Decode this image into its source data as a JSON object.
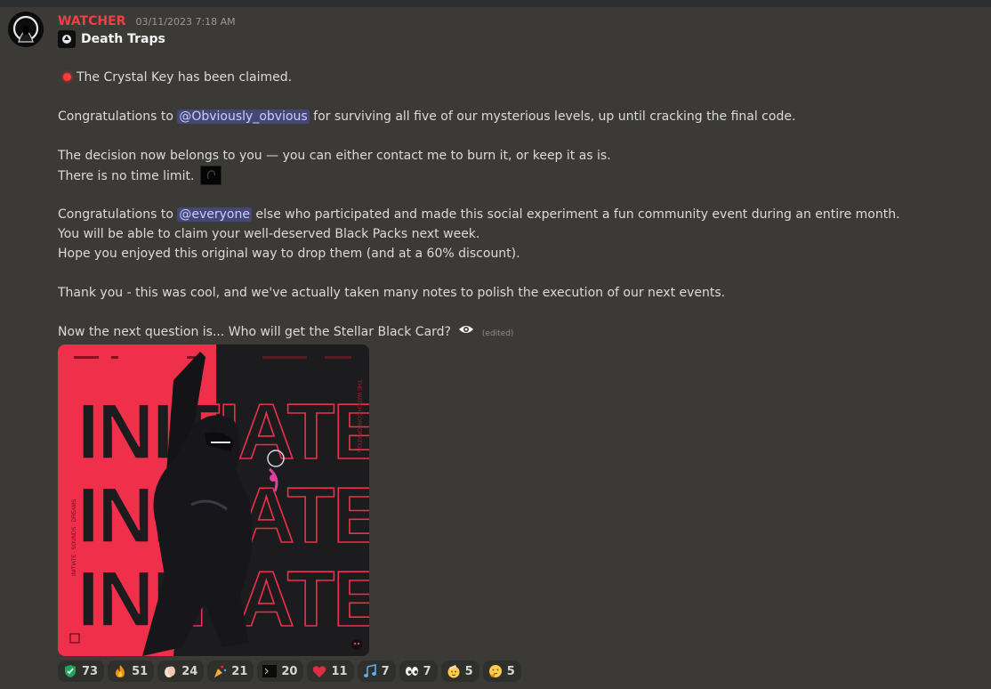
{
  "message": {
    "author": "WATCHER",
    "timestamp": "03/11/2023 7:18 AM",
    "subtitle": "Death Traps",
    "lines": {
      "l1": "The Crystal Key has been claimed.",
      "l2_pre": "Congratulations to ",
      "l2_mention": "@Obviously_obvious",
      "l2_post": " for surviving all five of our mysterious levels, up until cracking the final code.",
      "l3": "The decision now belongs to you — you can either contact me to burn it, or keep it as is.",
      "l4": "There is no time limit.",
      "l5_pre": "Congratulations to ",
      "l5_mention": "@everyone",
      "l5_post": " else who participated and made this social experiment a fun community event during an entire month.",
      "l6": "You will be able to claim your well-deserved Black Packs next week.",
      "l7": "Hope you enjoyed this original way to drop them (and at a 60% discount).",
      "l8": "Thank you - this was cool, and we've actually taken many notes to polish the execution of our next events.",
      "l9": "Now the next question is... Who will get the Stellar Black Card?",
      "edited": "(edited)"
    },
    "image": {
      "word": "INITIATE",
      "side_text_left": "INITIATE · SOUNDS · DREAMS",
      "side_text_right": "THE WATCH CORPORATION"
    }
  },
  "reactions": [
    {
      "icon": "green-shield-icon",
      "count": "73"
    },
    {
      "icon": "fire-icon",
      "count": "51"
    },
    {
      "icon": "clap-icon",
      "count": "24"
    },
    {
      "icon": "party-popper-icon",
      "count": "21"
    },
    {
      "icon": "terminal-icon",
      "count": "20"
    },
    {
      "icon": "heart-icon",
      "count": "11"
    },
    {
      "icon": "music-notes-icon",
      "count": "7"
    },
    {
      "icon": "eyes-icon",
      "count": "7"
    },
    {
      "icon": "salute-icon",
      "count": "5"
    },
    {
      "icon": "thinking-icon",
      "count": "5"
    }
  ],
  "colors": {
    "background": "#3b3a36",
    "username": "#f23f43",
    "mention_bg": "#5865f2",
    "image_red": "#f0304a"
  }
}
